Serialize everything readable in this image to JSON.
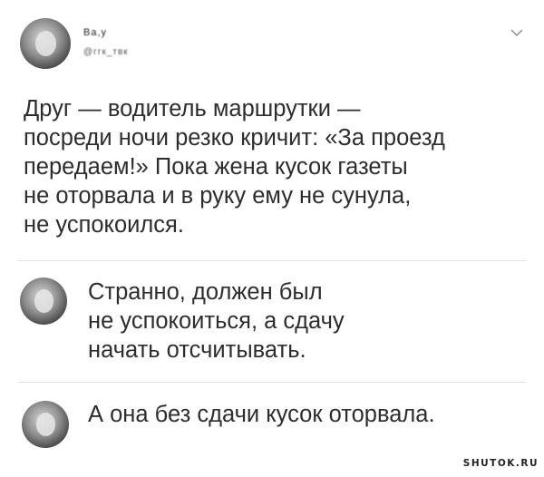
{
  "post": {
    "author_name": "Ва,у",
    "author_handle": "@ггк_твк",
    "text": "Друг — водитель маршрутки —\nпосреди ночи резко кричит: «За проезд\nпередаем!» Пока жена кусок газеты\nне оторвала и в руку ему не сунула,\nне успокоился.",
    "menu_icon": "chevron-down-icon"
  },
  "replies": [
    {
      "text": "Странно, должен был\nне успокоиться, а сдачу\nначать отсчитывать."
    },
    {
      "text": "А она без сдачи кусок оторвала."
    }
  ],
  "watermark": "SHUTOK.RU"
}
